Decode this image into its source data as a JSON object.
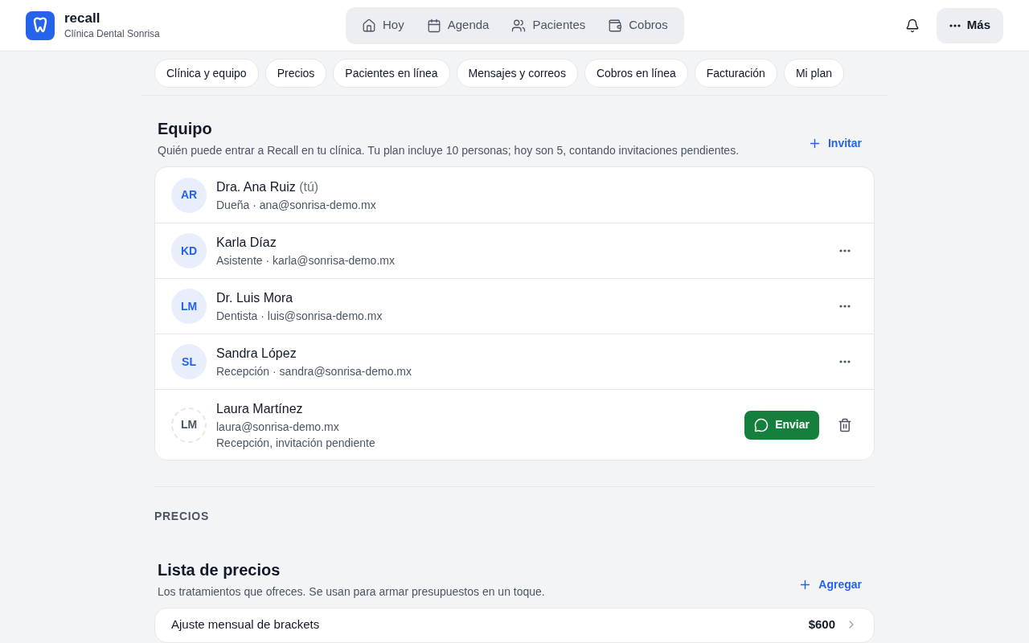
{
  "brand": {
    "name": "recall",
    "clinic": "Clínica Dental Sonrisa"
  },
  "nav": [
    {
      "label": "Hoy",
      "selected": false
    },
    {
      "label": "Agenda",
      "selected": false
    },
    {
      "label": "Pacientes",
      "selected": false
    },
    {
      "label": "Cobros",
      "selected": false
    }
  ],
  "more_button": "Más",
  "settings_tabs": [
    {
      "label": "Clínica y equipo",
      "selected": false
    },
    {
      "label": "Precios",
      "selected": false
    },
    {
      "label": "Pacientes en línea",
      "selected": false
    },
    {
      "label": "Mensajes y correos",
      "selected": false
    },
    {
      "label": "Cobros en línea",
      "selected": false
    },
    {
      "label": "Facturación",
      "selected": false
    },
    {
      "label": "Mi plan",
      "selected": false
    }
  ],
  "team": {
    "title": "Equipo",
    "subtitle": "Quién puede entrar a Recall en tu clínica. Tu plan incluye 10 personas; hoy son 5, contando invitaciones pendientes.",
    "action": "Invitar",
    "members": [
      {
        "kind": "member",
        "initials": "AR",
        "name": "Dra. Ana Ruiz",
        "suffix": "(tú)",
        "lines": [
          "Dueña · ana@sonrisa-demo.mx"
        ],
        "menu": false
      },
      {
        "kind": "member",
        "initials": "KD",
        "name": "Karla Díaz",
        "lines": [
          "Asistente · karla@sonrisa-demo.mx"
        ],
        "menu": true
      },
      {
        "kind": "member",
        "initials": "LM",
        "name": "Dr. Luis Mora",
        "lines": [
          "Dentista · luis@sonrisa-demo.mx"
        ],
        "menu": true
      },
      {
        "kind": "member",
        "initials": "SL",
        "name": "Sandra López",
        "lines": [
          "Recepción · sandra@sonrisa-demo.mx"
        ],
        "menu": true
      },
      {
        "kind": "pending",
        "initials": "LM",
        "name": "Laura Martínez",
        "lines": [
          "laura@sonrisa-demo.mx",
          "Recepción, invitación pendiente"
        ],
        "send": "Enviar",
        "menu": false
      }
    ]
  },
  "prices_section": "PRECIOS",
  "price_list": {
    "title": "Lista de precios",
    "subtitle": "Los tratamientos que ofreces. Se usan para armar presupuestos en un toque.",
    "action": "Agregar",
    "items": [
      {
        "name": "Ajuste mensual de brackets",
        "price": "$600"
      }
    ]
  }
}
